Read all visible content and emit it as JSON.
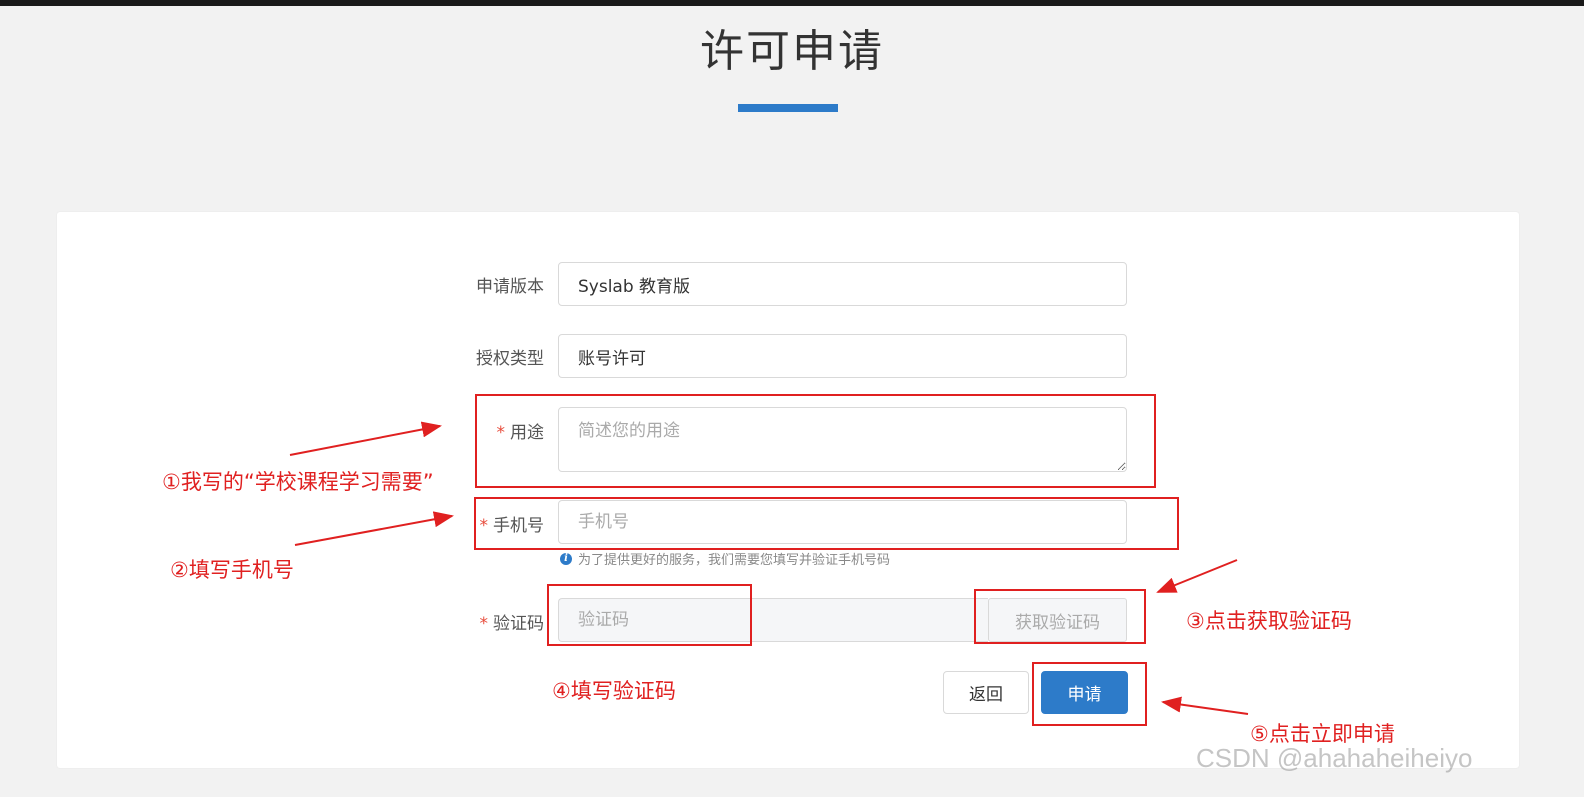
{
  "page": {
    "title": "许可申请"
  },
  "form": {
    "version": {
      "label": "申请版本",
      "value": "Syslab 教育版"
    },
    "license_type": {
      "label": "授权类型",
      "value": "账号许可"
    },
    "purpose": {
      "required_mark": "*",
      "label": "用途",
      "placeholder": "简述您的用途"
    },
    "phone": {
      "required_mark": "*",
      "label": "手机号",
      "placeholder": "手机号",
      "hint": "为了提供更好的服务，我们需要您填写并验证手机号码",
      "hint_icon": "info-icon"
    },
    "code": {
      "required_mark": "*",
      "label": "验证码",
      "placeholder": "验证码",
      "get_code_label": "获取验证码"
    },
    "buttons": {
      "back_label": "返回",
      "apply_label": "申请"
    }
  },
  "annotations": [
    "①我写的“学校课程学习需要”",
    "②填写手机号",
    "③点击获取验证码",
    "④填写验证码",
    "⑤点击立即申请"
  ],
  "watermark": "CSDN @ahahaheiheiyo",
  "colors": {
    "accent": "#2d7bc9",
    "annotation": "#e02020",
    "required": "#e74c3c"
  }
}
